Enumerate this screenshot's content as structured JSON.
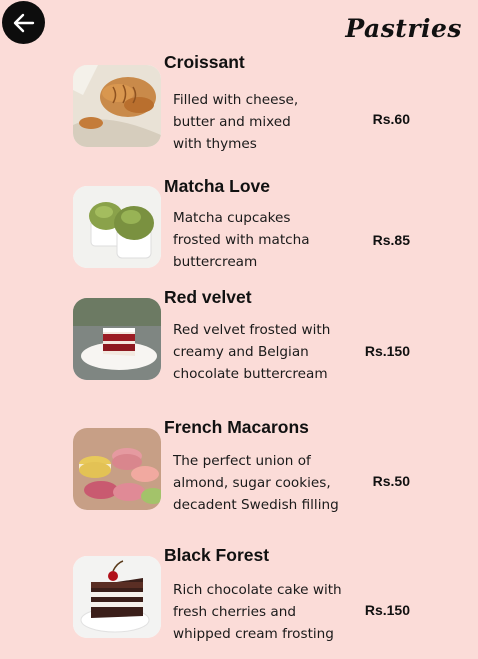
{
  "header": {
    "back_icon": "arrow-left-icon",
    "title": "Pastries"
  },
  "items": [
    {
      "name": "Croissant",
      "description": "Filled with cheese,\nbutter and mixed\nwith thymes",
      "price": "Rs.60",
      "image": "croissant-photo"
    },
    {
      "name": "Matcha Love",
      "description": "Matcha cupcakes\nfrosted with matcha\nbuttercream",
      "price": "Rs.85",
      "image": "matcha-cupcake-photo"
    },
    {
      "name": "Red velvet",
      "description": " Red velvet frosted with\ncreamy and Belgian\nchocolate buttercream",
      "price": "Rs.150",
      "image": "red-velvet-cake-photo"
    },
    {
      "name": "French Macarons",
      "description": "The perfect union of\nalmond, sugar cookies,\ndecadent Swedish filling",
      "price": "Rs.50",
      "image": "macarons-photo"
    },
    {
      "name": "Black Forest",
      "description": "Rich chocolate cake with\nfresh cherries and\nwhipped cream frosting",
      "price": "Rs.150",
      "image": "black-forest-cake-photo"
    }
  ]
}
